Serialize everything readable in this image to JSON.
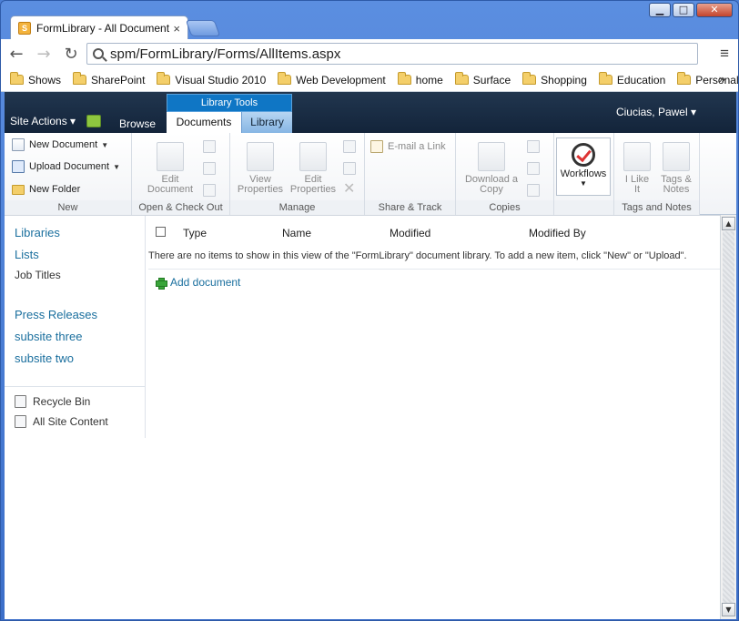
{
  "browser": {
    "tab_title": "FormLibrary - All Documents",
    "tab_close": "×",
    "url": "spm/FormLibrary/Forms/AllItems.aspx",
    "window_controls": {
      "minimize": "▁",
      "maximize": "□",
      "close": "✕"
    },
    "nav": {
      "back": "←",
      "forward": "→",
      "reload": "↻"
    },
    "menu_icon": "≡",
    "bookmarks": [
      "Shows",
      "SharePoint",
      "Visual Studio 2010",
      "Web Development",
      "home",
      "Surface",
      "Shopping",
      "Education",
      "Personal"
    ],
    "bookmarks_more": "»"
  },
  "sharepoint": {
    "site_actions": "Site Actions ▾",
    "tab_browse": "Browse",
    "contextual_group": "Library Tools",
    "tab_documents": "Documents",
    "tab_library": "Library",
    "user": "Ciucias, Pawel ▾"
  },
  "ribbon": {
    "new_group": {
      "label": "New",
      "new_document": "New Document",
      "upload_document": "Upload Document",
      "new_folder": "New Folder",
      "caret": "▼"
    },
    "open_group": {
      "label": "Open & Check Out",
      "edit_document_1": "Edit",
      "edit_document_2": "Document"
    },
    "manage_group": {
      "label": "Manage",
      "view_properties_1": "View",
      "view_properties_2": "Properties",
      "edit_properties_1": "Edit",
      "edit_properties_2": "Properties"
    },
    "share_group": {
      "label": "Share & Track",
      "email_link": "E-mail a Link"
    },
    "copies_group": {
      "label": "Copies",
      "download_1": "Download a",
      "download_2": "Copy"
    },
    "workflows_group": {
      "workflows": "Workflows",
      "caret": "▼"
    },
    "tags_group": {
      "label": "Tags and Notes",
      "i_like_1": "I Like",
      "i_like_2": "It",
      "tags_1": "Tags &",
      "tags_2": "Notes"
    }
  },
  "left_nav": {
    "libraries": "Libraries",
    "lists": "Lists",
    "job_titles": "Job Titles",
    "press_releases": "Press Releases",
    "subsite_three": "subsite three",
    "subsite_two": "subsite two",
    "recycle_bin": "Recycle Bin",
    "all_site_content": "All Site Content"
  },
  "list": {
    "columns": [
      "Type",
      "Name",
      "Modified",
      "Modified By"
    ],
    "empty_message": "There are no items to show in this view of the \"FormLibrary\" document library. To add a new item, click \"New\" or \"Upload\".",
    "add_document": "Add document"
  },
  "scrollbar": {
    "up": "▲",
    "down": "▼"
  }
}
